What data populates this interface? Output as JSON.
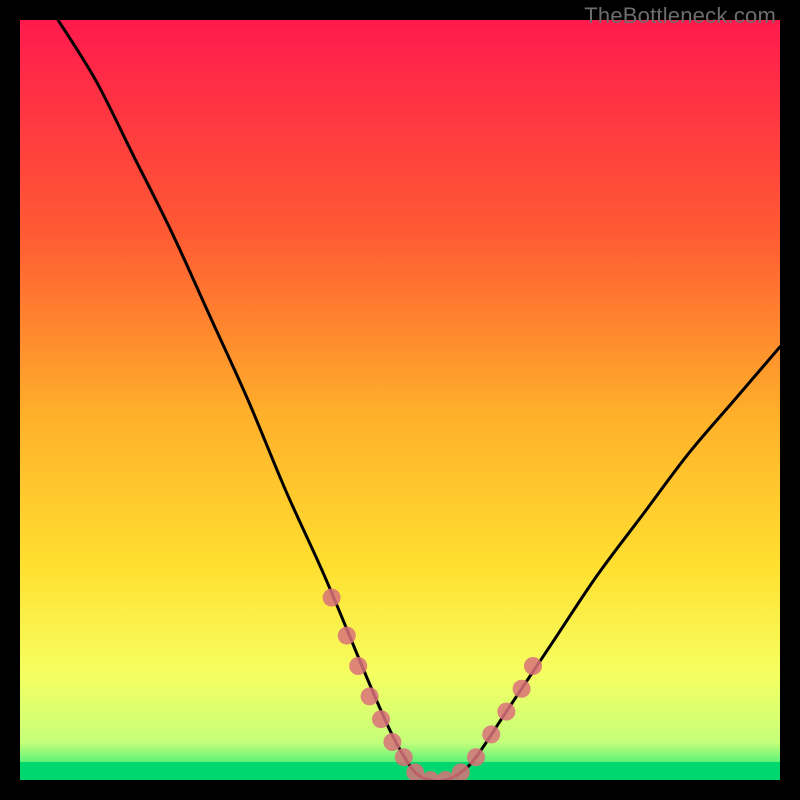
{
  "watermark": "TheBottleneck.com",
  "chart_data": {
    "type": "line",
    "title": "",
    "xlabel": "",
    "ylabel": "",
    "xlim": [
      0,
      100
    ],
    "ylim": [
      0,
      100
    ],
    "background_gradient": {
      "top": "#ff1a4d",
      "mid1": "#ff8a2a",
      "mid2": "#ffe030",
      "mid3": "#faff66",
      "bottom": "#00e676"
    },
    "series": [
      {
        "name": "bottleneck-curve",
        "color": "#000000",
        "x": [
          5,
          10,
          15,
          20,
          25,
          30,
          35,
          40,
          45,
          48,
          50,
          52,
          54,
          56,
          58,
          60,
          64,
          70,
          76,
          82,
          88,
          94,
          100
        ],
        "y": [
          100,
          92,
          82,
          72,
          61,
          50,
          38,
          27,
          15,
          8,
          4,
          1,
          0,
          0,
          1,
          3,
          9,
          18,
          27,
          35,
          43,
          50,
          57
        ]
      }
    ],
    "markers": {
      "name": "highlight-points",
      "color": "#d9717a",
      "points": [
        {
          "x": 41,
          "y": 24
        },
        {
          "x": 43,
          "y": 19
        },
        {
          "x": 44.5,
          "y": 15
        },
        {
          "x": 46,
          "y": 11
        },
        {
          "x": 47.5,
          "y": 8
        },
        {
          "x": 49,
          "y": 5
        },
        {
          "x": 50.5,
          "y": 3
        },
        {
          "x": 52,
          "y": 1
        },
        {
          "x": 54,
          "y": 0
        },
        {
          "x": 56,
          "y": 0
        },
        {
          "x": 58,
          "y": 1
        },
        {
          "x": 60,
          "y": 3
        },
        {
          "x": 62,
          "y": 6
        },
        {
          "x": 64,
          "y": 9
        },
        {
          "x": 66,
          "y": 12
        },
        {
          "x": 67.5,
          "y": 15
        }
      ]
    },
    "bottom_band": {
      "from_y": 0,
      "to_y": 4,
      "color": "#00e676"
    }
  }
}
